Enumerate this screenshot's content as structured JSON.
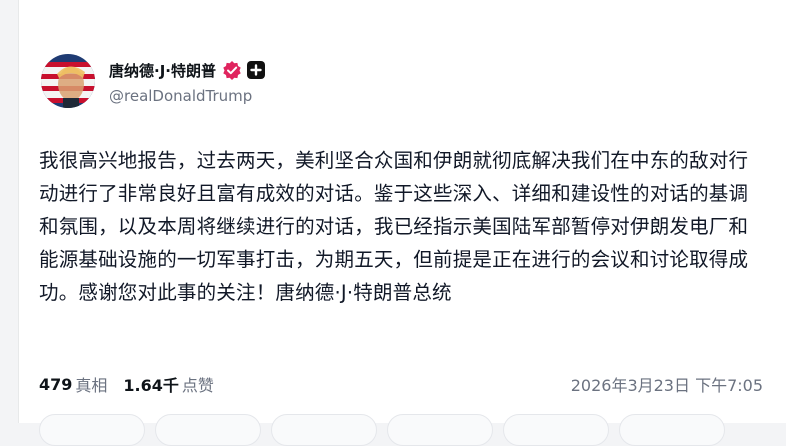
{
  "post": {
    "author": {
      "display_name": "唐纳德·J·特朗普",
      "handle": "@realDonaldTrump",
      "verified_badge_icon": "verified-badge-icon",
      "plus_icon": "plus-square-icon"
    },
    "text": "我很高兴地报告，过去两天，美利坚合众国和伊朗就彻底解决我们在中东的敌对行动进行了非常良好且富有成效的对话。鉴于这些深入、详细和建设性的对话的基调和氛围，以及本周将继续进行的对话，我已经指示美国陆军部暂停对伊朗发电厂和能源基础设施的一切军事打击，为期五天，但前提是正在进行的会议和讨论取得成功。感谢您对此事的关注！唐纳德·J·特朗普总统",
    "stats": {
      "retruths_count": "479",
      "retruths_label": "真相",
      "likes_count": "1.64千",
      "likes_label": "点赞"
    },
    "timestamp": "2026年3月23日 下午7:05"
  },
  "colors": {
    "accent_badge": "#e0245e",
    "text_primary": "#0f1419",
    "text_secondary": "#6b7280"
  }
}
